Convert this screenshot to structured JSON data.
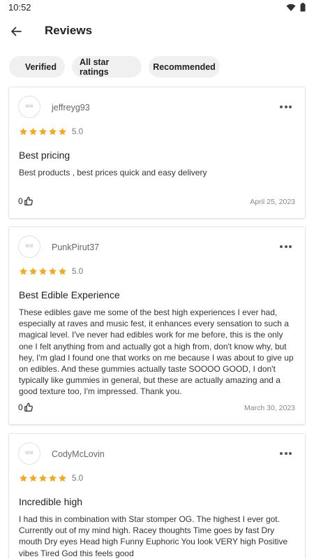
{
  "status": {
    "time": "10:52",
    "icons": [
      "wifi-icon",
      "battery-icon"
    ]
  },
  "header": {
    "title": "Reviews",
    "back_icon": "arrow-left-icon"
  },
  "filters": [
    {
      "label": "Verified"
    },
    {
      "label": "All star ratings"
    },
    {
      "label": "Recommended"
    }
  ],
  "colors": {
    "star": "#f2a91c",
    "chip_bg": "#f0f0f0"
  },
  "reviews": [
    {
      "username": "jeffreyg93",
      "avatar_text": "WM",
      "stars": 5,
      "rating": "5.0",
      "title": "Best pricing",
      "body": "Best products , best prices quick and easy delivery",
      "helpful_count": "0",
      "date": "April 25, 2023"
    },
    {
      "username": "PunkPirut37",
      "avatar_text": "WM",
      "stars": 5,
      "rating": "5.0",
      "title": "Best Edible Experience",
      "body": "These edibles gave me some of the best high experiences I ever had, especially at raves and music fest, it enhances every sensation to such a magical level. I've never had edibles work for me before, this is the only one I felt anything from and actually got a high from, don't know why, but hey, I'm glad I found one that works on me because I was about to give up on edibles. And these gummies actually taste SOOOO GOOD, I don't typically like gummies in general, but these are actually amazing and a good texture too, I'm impressed. Thank you.",
      "helpful_count": "0",
      "date": "March 30, 2023"
    },
    {
      "username": "CodyMcLovin",
      "avatar_text": "WM",
      "stars": 5,
      "rating": "5.0",
      "title": "Incredible high",
      "body": "I had this in combination with Star stomper OG. The highest I ever got. Currently out of my mind high. Racey thoughts Time goes by fast Dry mouth Dry eyes Head high Funny Euphoric You look VERY high Positive vibes Tired God this feels good",
      "helpful_count": "",
      "date": ""
    }
  ]
}
